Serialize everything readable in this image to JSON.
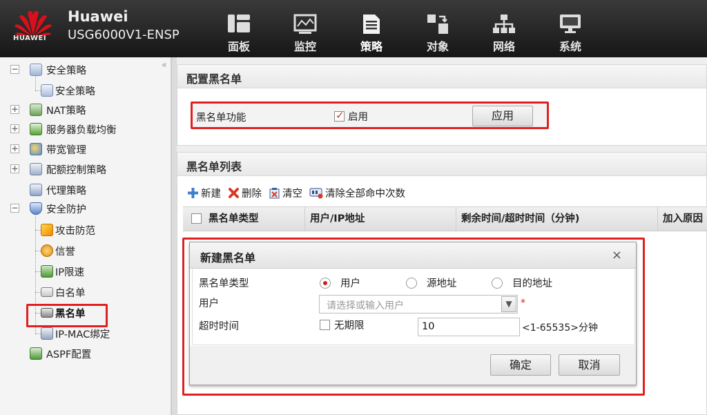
{
  "header": {
    "logo_text": "HUAWEI",
    "brand_name": "Huawei",
    "model": "USG6000V1-ENSP",
    "nav": [
      {
        "label": "面板",
        "icon": "dashboard-icon"
      },
      {
        "label": "监控",
        "icon": "monitor-icon"
      },
      {
        "label": "策略",
        "icon": "policy-icon",
        "active": true
      },
      {
        "label": "对象",
        "icon": "object-icon"
      },
      {
        "label": "网络",
        "icon": "network-icon"
      },
      {
        "label": "系统",
        "icon": "system-icon"
      }
    ]
  },
  "sidebar": {
    "collapse_glyph": "«",
    "items": [
      {
        "label": "安全策略",
        "expander": "−",
        "icon": "security-policy-icon"
      },
      {
        "label": "安全策略",
        "icon": "security-policy-sub-icon"
      },
      {
        "label": "NAT策略",
        "expander": "+",
        "icon": "nat-icon"
      },
      {
        "label": "服务器负载均衡",
        "expander": "+",
        "icon": "server-lb-icon"
      },
      {
        "label": "带宽管理",
        "expander": "+",
        "icon": "bandwidth-icon"
      },
      {
        "label": "配额控制策略",
        "expander": "+",
        "icon": "quota-icon"
      },
      {
        "label": "代理策略",
        "icon": "proxy-icon"
      },
      {
        "label": "安全防护",
        "expander": "−",
        "icon": "shield-icon"
      },
      {
        "label": "攻击防范",
        "icon": "attack-defense-icon"
      },
      {
        "label": "信誉",
        "icon": "reputation-icon"
      },
      {
        "label": "IP限速",
        "icon": "ip-rate-limit-icon"
      },
      {
        "label": "白名单",
        "icon": "whitelist-icon"
      },
      {
        "label": "黑名单",
        "icon": "blacklist-icon",
        "selected": true
      },
      {
        "label": "IP-MAC绑定",
        "icon": "ip-mac-bind-icon"
      },
      {
        "label": "ASPF配置",
        "icon": "aspf-icon"
      }
    ]
  },
  "config_panel": {
    "title": "配置黑名单",
    "feature_label": "黑名单功能",
    "enable_label": "启用",
    "enable_checked": true,
    "apply_button": "应用"
  },
  "list_panel": {
    "title": "黑名单列表",
    "toolbar": [
      {
        "label": "新建",
        "icon": "add-icon"
      },
      {
        "label": "删除",
        "icon": "delete-icon"
      },
      {
        "label": "清空",
        "icon": "clear-icon"
      },
      {
        "label": "清除全部命中次数",
        "icon": "clear-hits-icon"
      }
    ],
    "columns": [
      "黑名单类型",
      "用户/IP地址",
      "剩余时间/超时时间（分钟)",
      "加入原因"
    ]
  },
  "dialog": {
    "title": "新建黑名单",
    "close_glyph": "×",
    "type_label": "黑名单类型",
    "type_options": [
      {
        "label": "用户",
        "selected": true
      },
      {
        "label": "源地址",
        "selected": false
      },
      {
        "label": "目的地址",
        "selected": false
      }
    ],
    "user_label": "用户",
    "user_placeholder": "请选择或输入用户",
    "required_mark": "*",
    "timeout_label": "超时时间",
    "unlimited_label": "无期限",
    "unlimited_checked": false,
    "timeout_value": "10",
    "timeout_hint": "<1-65535>分钟",
    "ok_button": "确定",
    "cancel_button": "取消"
  },
  "colors": {
    "highlight": "#e02020",
    "header_bg": "#222222",
    "brand_red": "#d7101b"
  }
}
